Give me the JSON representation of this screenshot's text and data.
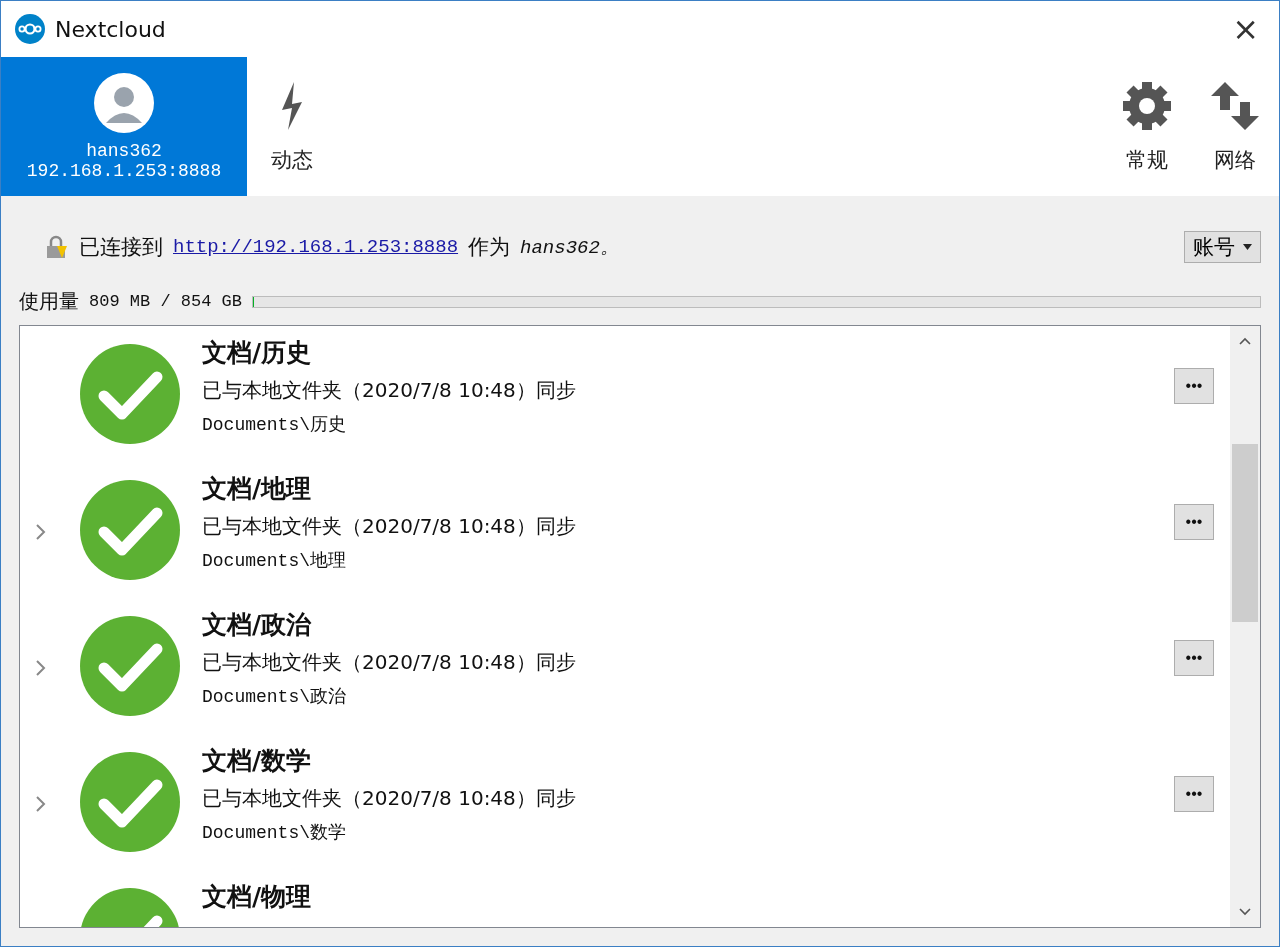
{
  "window": {
    "title": "Nextcloud",
    "close": "×"
  },
  "toolbar": {
    "tabs": [
      {
        "kind": "account",
        "name": "hans362",
        "server": "192.168.1.253:8888",
        "selected": true
      },
      {
        "kind": "activity",
        "label": "动态",
        "selected": false
      }
    ],
    "actions": [
      {
        "kind": "settings",
        "label": "常规"
      },
      {
        "kind": "network",
        "label": "网络"
      }
    ]
  },
  "connection": {
    "prefix": "已连接到",
    "link": "http://192.168.1.253:8888",
    "middle": "作为",
    "user": "hans362。",
    "account_button": "账号"
  },
  "usage": {
    "label": "使用量",
    "reading": "809 MB / 854 GB",
    "level": 0.001
  },
  "folders": [
    {
      "title": "文档/历史",
      "status": "已与本地文件夹（2020/7/8 10:48）同步",
      "path": "Documents\\历史",
      "expandable": false,
      "menu": "•••"
    },
    {
      "title": "文档/地理",
      "status": "已与本地文件夹（2020/7/8 10:48）同步",
      "path": "Documents\\地理",
      "expandable": true,
      "menu": "•••"
    },
    {
      "title": "文档/政治",
      "status": "已与本地文件夹（2020/7/8 10:48）同步",
      "path": "Documents\\政治",
      "expandable": true,
      "menu": "•••"
    },
    {
      "title": "文档/数学",
      "status": "已与本地文件夹（2020/7/8 10:48）同步",
      "path": "Documents\\数学",
      "expandable": true,
      "menu": "•••"
    },
    {
      "title": "文档/物理",
      "expandable": false
    }
  ]
}
